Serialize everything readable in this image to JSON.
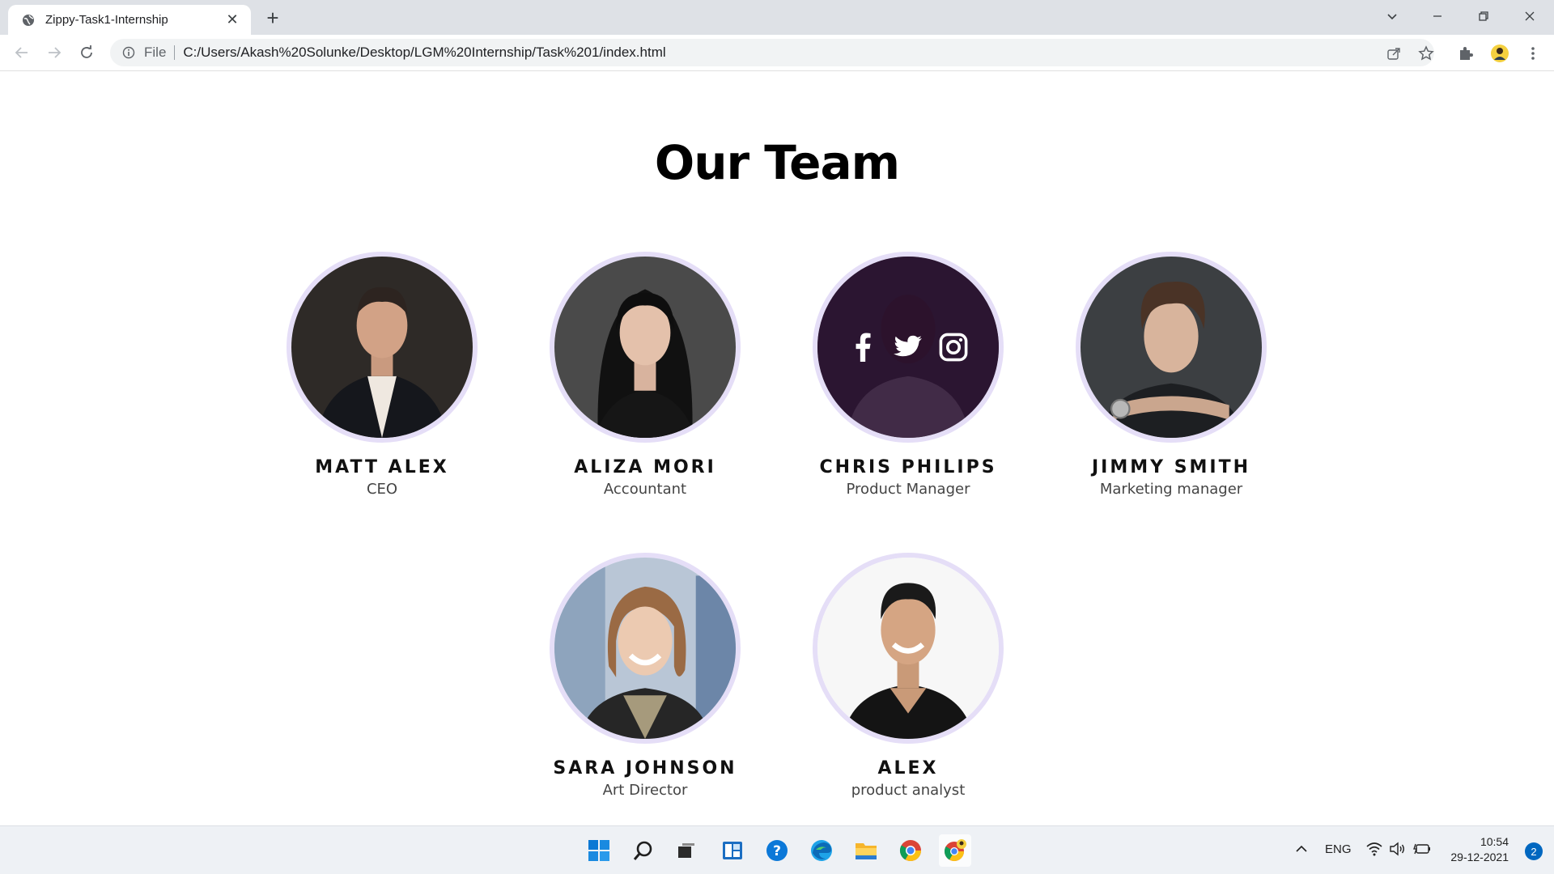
{
  "browser": {
    "tab_title": "Zippy-Task1-Internship",
    "scheme_label": "File",
    "url": "C:/Users/Akash%20Solunke/Desktop/LGM%20Internship/Task%201/index.html"
  },
  "page": {
    "title": "Our Team",
    "members": [
      {
        "name": "MATT ALEX",
        "role": "CEO"
      },
      {
        "name": "ALIZA MORI",
        "role": "Accountant"
      },
      {
        "name": "CHRIS PHILIPS",
        "role": "Product Manager"
      },
      {
        "name": "JIMMY SMITH",
        "role": "Marketing manager"
      },
      {
        "name": "SARA JOHNSON",
        "role": "Art Director"
      },
      {
        "name": "ALEX",
        "role": "product analyst"
      }
    ]
  },
  "taskbar": {
    "language": "ENG",
    "time": "10:54",
    "date": "29-12-2021",
    "notification_count": "2"
  },
  "colors": {
    "avatar_ring": "#e5def7",
    "hover_overlay": "#280c30"
  }
}
